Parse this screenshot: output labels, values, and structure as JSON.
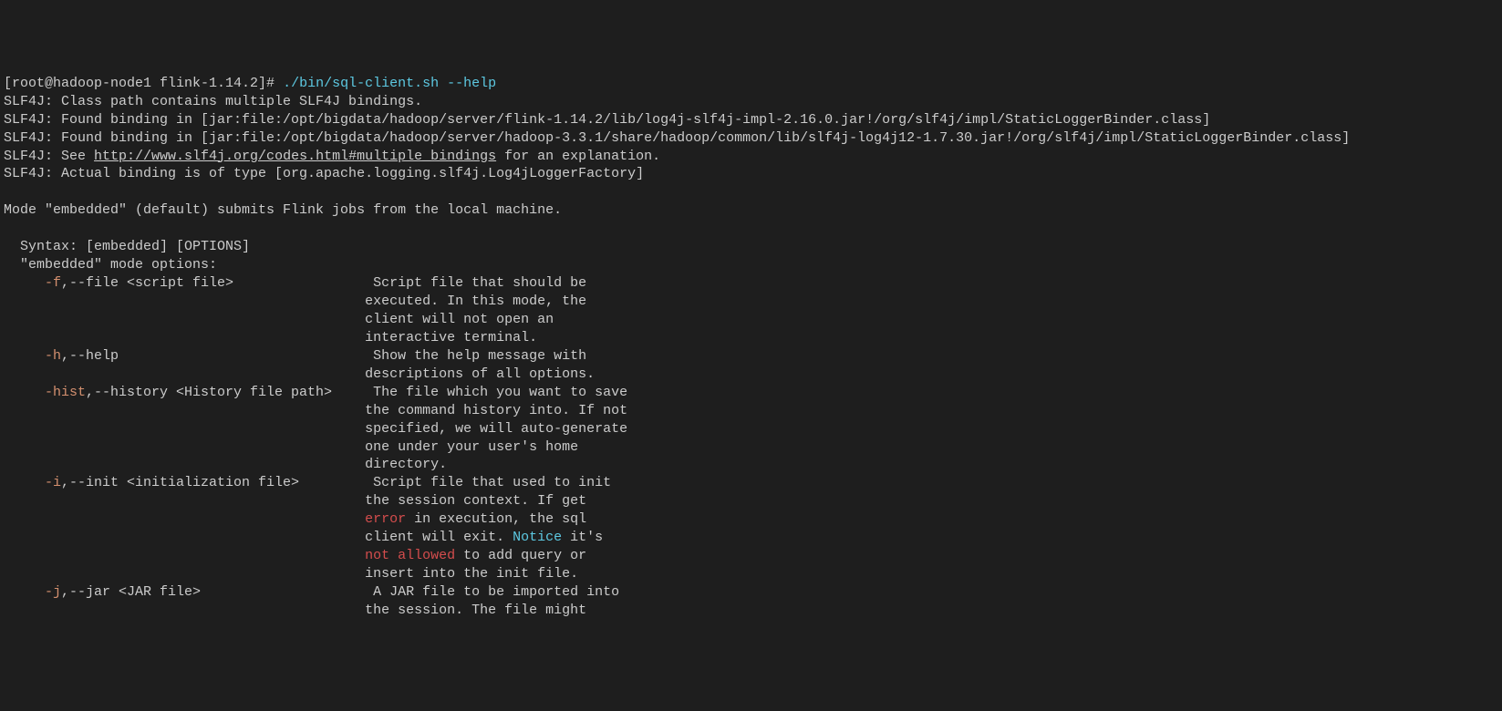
{
  "prompt": {
    "line1": "[root@hadoop-node1 flink-1.14.2]# ",
    "command": "./bin/sql-client.sh --help"
  },
  "slf4j": {
    "l1": "SLF4J: Class path contains multiple SLF4J bindings.",
    "l2": "SLF4J: Found binding in [jar:file:/opt/bigdata/hadoop/server/flink-1.14.2/lib/log4j-slf4j-impl-2.16.0.jar!/org/slf4j/impl/StaticLoggerBinder.class]",
    "l3": "SLF4J: Found binding in [jar:file:/opt/bigdata/hadoop/server/hadoop-3.3.1/share/hadoop/common/lib/slf4j-log4j12-1.7.30.jar!/org/slf4j/impl/StaticLoggerBinder.class]",
    "l4a": "SLF4J: See ",
    "l4link": "http://www.slf4j.org/codes.html#multiple_bindings",
    "l4b": " for an explanation.",
    "l5": "SLF4J: Actual binding is of type [org.apache.logging.slf4j.Log4jLoggerFactory]"
  },
  "mode": {
    "desc": "Mode \"embedded\" (default) submits Flink jobs from the local machine.",
    "syntax": "  Syntax: [embedded] [OPTIONS]",
    "options_header": "  \"embedded\" mode options:"
  },
  "opts": {
    "f": {
      "flag": "     -f",
      "rest": ",--file <script file>                 Script file that should be",
      "d2": "                                            executed. In this mode, the",
      "d3": "                                            client will not open an",
      "d4": "                                            interactive terminal."
    },
    "h": {
      "flag": "     -h",
      "rest": ",--help                               Show the help message with",
      "d2": "                                            descriptions of all options."
    },
    "hist": {
      "flag": "     -hist",
      "rest": ",--history <History file path>     The file which you want to save",
      "d2": "                                            the command history into. If not",
      "d3": "                                            specified, we will auto-generate",
      "d4": "                                            one under your user's home",
      "d5": "                                            directory."
    },
    "i": {
      "flag": "     -i",
      "rest": ",--init <initialization file>         Script file that used to init",
      "d2": "                                            the session context. If get",
      "d3a": "                                            ",
      "d3err": "error",
      "d3b": " in execution, the sql",
      "d4a": "                                            client will exit. ",
      "d4notice": "Notice",
      "d4b": " it's",
      "d5a": "                                            ",
      "d5na": "not allowed",
      "d5b": " to add query or",
      "d6": "                                            insert into the init file."
    },
    "j": {
      "flag": "     -j",
      "rest": ",--jar <JAR file>                     A JAR file to be imported into",
      "d2": "                                            the session. The file might"
    }
  }
}
